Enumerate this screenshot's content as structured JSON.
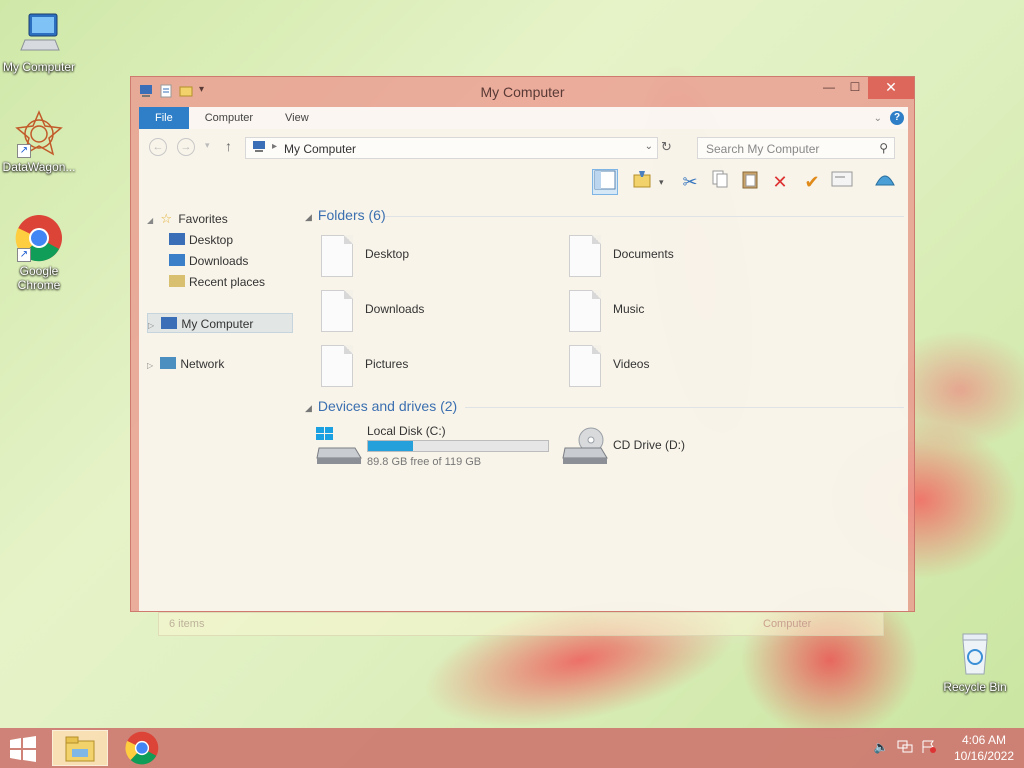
{
  "desktop": {
    "icons": [
      {
        "label": "My Computer"
      },
      {
        "label": "DataWagon..."
      },
      {
        "label": "Google Chrome"
      },
      {
        "label": "Recycle Bin"
      }
    ]
  },
  "window": {
    "title": "My Computer",
    "controls": {
      "minimize": "—",
      "maximize": "☐",
      "close": "✕"
    },
    "ribbon_tabs": [
      "File",
      "Computer",
      "View"
    ],
    "address": {
      "path": "My Computer",
      "separator": "▸"
    },
    "search": {
      "placeholder": "Search My Computer"
    },
    "navigation": {
      "favorites": {
        "label": "Favorites",
        "items": [
          "Desktop",
          "Downloads",
          "Recent places"
        ]
      },
      "my_computer": "My Computer",
      "network": "Network"
    },
    "groups": {
      "folders": {
        "title": "Folders (6)",
        "items": [
          "Desktop",
          "Documents",
          "Downloads",
          "Music",
          "Pictures",
          "Videos"
        ]
      },
      "devices": {
        "title": "Devices and drives (2)",
        "drives": [
          {
            "name": "Local Disk (C:)",
            "free_text": "89.8 GB free of 119 GB",
            "used_fraction": 0.25
          },
          {
            "name": "CD Drive (D:)"
          }
        ]
      }
    },
    "status": {
      "items": "6 items",
      "location": "Computer"
    }
  },
  "taskbar": {
    "clock": {
      "time": "4:06 AM",
      "date": "10/16/2022"
    }
  },
  "colors": {
    "accent": "#2e7fc7",
    "window_frame": "#ec948c",
    "drive_fill": "#26a0da",
    "group_header": "#3b6fb0"
  }
}
